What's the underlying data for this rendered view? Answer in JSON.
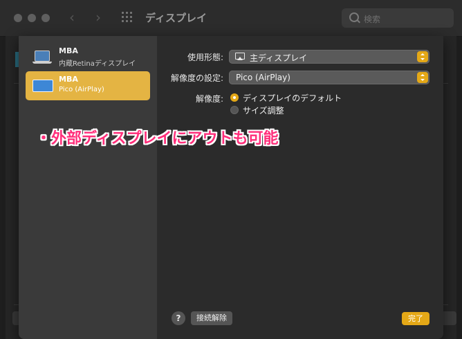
{
  "window": {
    "title": "ディスプレイ",
    "search_placeholder": "検索"
  },
  "sidebar": {
    "items": [
      {
        "name": "MBA",
        "subtitle": "内蔵Retinaディスプレイ",
        "icon": "laptop-icon",
        "selected": false
      },
      {
        "name": "MBA",
        "subtitle": "Pico (AirPlay)",
        "icon": "monitor-icon",
        "selected": true
      }
    ]
  },
  "settings": {
    "usage_label": "使用形態:",
    "usage_value": "主ディスプレイ",
    "resolution_setting_label": "解像度の設定:",
    "resolution_setting_value": "Pico (AirPlay)",
    "resolution_label": "解像度:",
    "resolution_options": [
      {
        "label": "ディスプレイのデフォルト",
        "selected": true
      },
      {
        "label": "サイズ調整",
        "selected": false
      }
    ]
  },
  "footer": {
    "help": "?",
    "disconnect": "接続解除",
    "done": "完了"
  },
  "annotation": "・外部ディスプレイにアウトも可能",
  "colors": {
    "accent": "#e4a817",
    "selection": "#e4b443",
    "annotation": "#ff2e7a"
  }
}
